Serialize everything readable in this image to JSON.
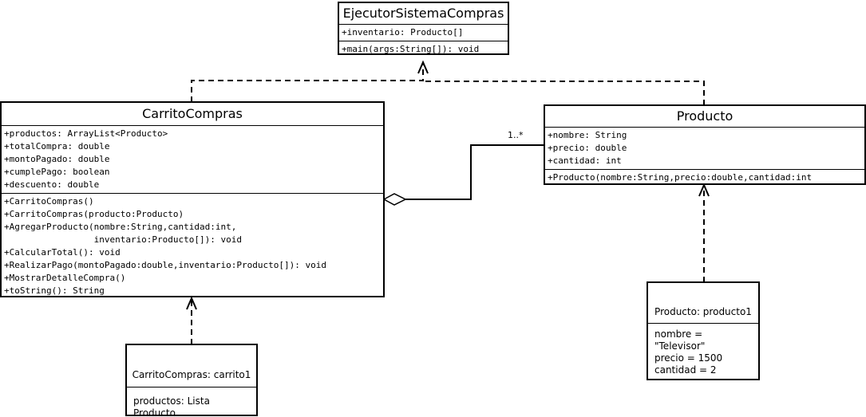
{
  "ejecutor": {
    "name": "EjecutorSistemaCompras",
    "attributes": [
      "+inventario: Producto[]"
    ],
    "methods": [
      "+main(args:String[]): void"
    ]
  },
  "carrito": {
    "name": "CarritoCompras",
    "attributes": [
      "+productos: ArrayList<Producto>",
      "+totalCompra: double",
      "+montoPagado: double",
      "+cumplePago: boolean",
      "+descuento: double"
    ],
    "methods": [
      "+CarritoCompras()",
      "+CarritoCompras(producto:Producto)",
      "+AgregarProducto(nombre:String,cantidad:int,",
      "                 inventario:Producto[]): void",
      "+CalcularTotal(): void",
      "+RealizarPago(montoPagado:double,inventario:Producto[]): void",
      "+MostrarDetalleCompra()",
      "+toString(): String"
    ]
  },
  "producto": {
    "name": "Producto",
    "attributes": [
      "+nombre: String",
      "+precio: double",
      "+cantidad: int"
    ],
    "methods": [
      "+Producto(nombre:String,precio:double,cantidad:int"
    ]
  },
  "carrito_obj": {
    "title": "CarritoCompras: carrito1",
    "lines": [
      "productos: Lista Producto"
    ]
  },
  "producto_obj": {
    "title": "Producto: producto1",
    "lines": [
      "nombre = \"Televisor\"",
      "precio = 1500",
      "cantidad = 2"
    ]
  },
  "multiplicity": "1..*"
}
